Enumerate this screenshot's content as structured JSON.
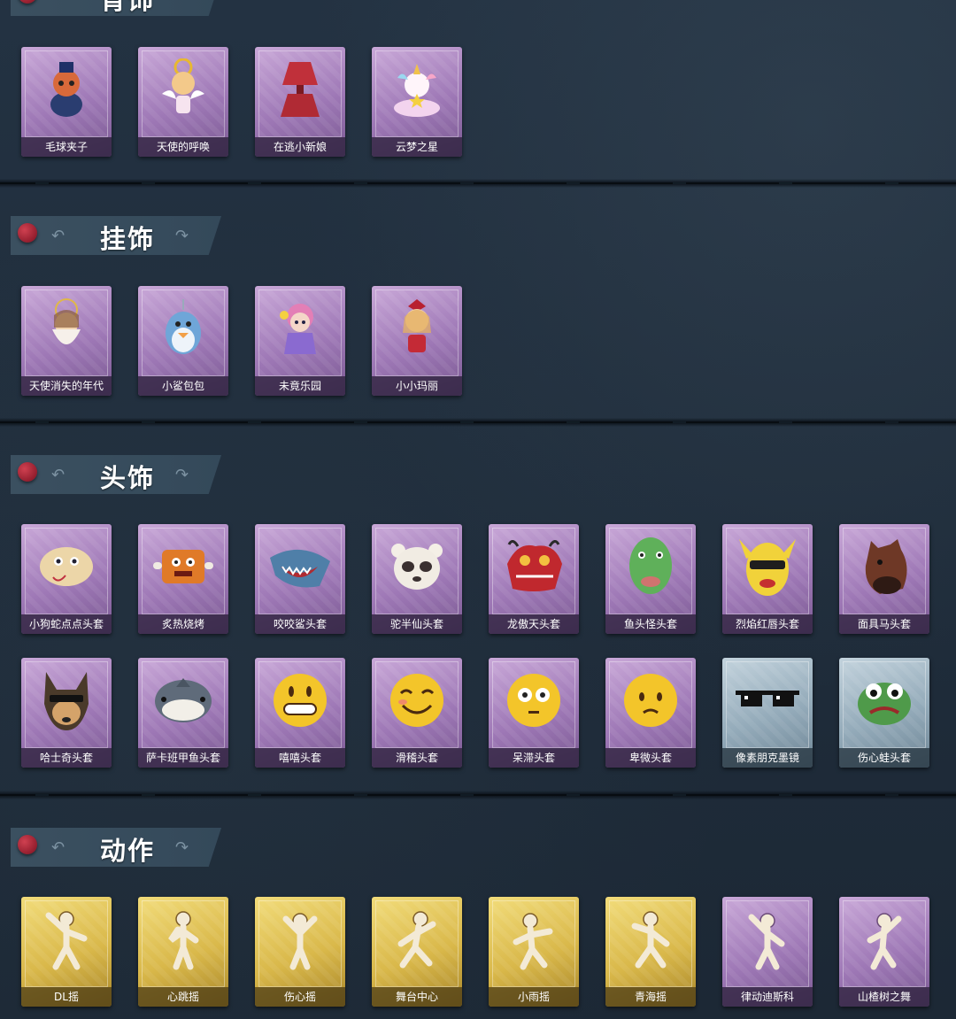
{
  "sections": {
    "back": {
      "title": "背饰",
      "items": [
        "毛球夹子",
        "天使的呼唤",
        "在逃小新娘",
        "云梦之星"
      ]
    },
    "hang": {
      "title": "挂饰",
      "items": [
        "天使消失的年代",
        "小鲨包包",
        "未竟乐园",
        "小小玛丽"
      ]
    },
    "head": {
      "title": "头饰",
      "items": [
        "小狗蛇点点头套",
        "炙热烧烤",
        "咬咬鲨头套",
        "驼半仙头套",
        "龙傲天头套",
        "鱼头怪头套",
        "烈焰红唇头套",
        "面具马头套",
        "哈士奇头套",
        "萨卡班甲鱼头套",
        "嘻嘻头套",
        "滑稽头套",
        "呆滞头套",
        "卑微头套",
        "像素朋克墨镜",
        "伤心蛙头套"
      ]
    },
    "action": {
      "title": "动作",
      "items": [
        "DL摇",
        "心跳摇",
        "伤心摇",
        "舞台中心",
        "小雨摇",
        "青海摇",
        "律动迪斯科",
        "山楂树之舞"
      ]
    }
  },
  "colors": {
    "background": "#1f2c39",
    "header": "#3b5060",
    "purple_card": "#9e78b6",
    "gold_card": "#d9b84a",
    "blue_card": "#93aab9",
    "pin": "#c03040"
  }
}
